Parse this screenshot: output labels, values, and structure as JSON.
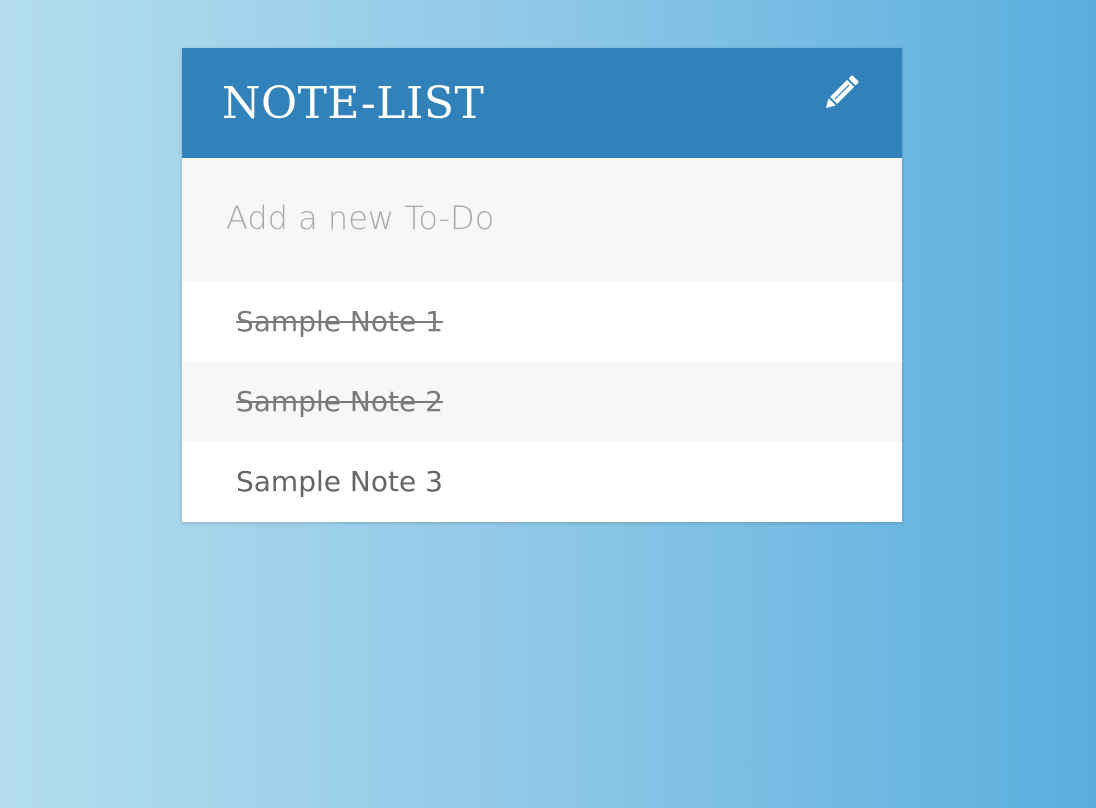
{
  "app": {
    "title": "NOTE-LIST",
    "edit_icon": "pencil-icon"
  },
  "new_todo": {
    "placeholder": "Add a new To-Do",
    "value": ""
  },
  "todos": [
    {
      "text": "Sample Note 1",
      "completed": true
    },
    {
      "text": "Sample Note 2",
      "completed": true
    },
    {
      "text": "Sample Note 3",
      "completed": false
    }
  ],
  "colors": {
    "header_bg": "#3182bb",
    "header_text": "#ffffff",
    "row_alt_bg": "#f7f7f7",
    "row_bg": "#ffffff",
    "item_text": "#666666",
    "placeholder_text": "#a8a8a8",
    "background_gradient": [
      "#b4ddef",
      "#5aaedd"
    ]
  }
}
